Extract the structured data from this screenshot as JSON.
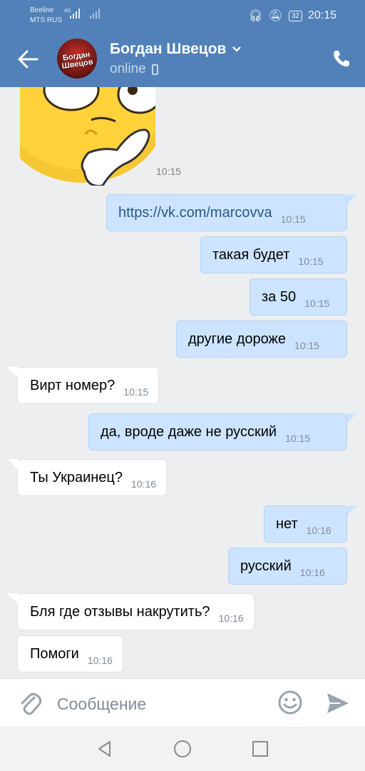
{
  "status_bar": {
    "carrier_line1": "Beeline",
    "carrier_line2": "MTS RUS",
    "network_tag": "4G",
    "battery": "32",
    "time": "20:15"
  },
  "header": {
    "contact_name": "Богдан Швецов",
    "status": "online",
    "avatar_text_line1": "Богдан",
    "avatar_text_line2": "Швецов"
  },
  "sticker": {
    "time": "10:15",
    "icon": "thinking-face-sticker"
  },
  "messages": [
    {
      "dir": "out",
      "text": "https://vk.com/marcovva",
      "time": "10:15",
      "link": true
    },
    {
      "dir": "out",
      "text": "такая будет",
      "time": "10:15"
    },
    {
      "dir": "out",
      "text": "за 50",
      "time": "10:15"
    },
    {
      "dir": "out",
      "text": "другие дороже",
      "time": "10:15"
    },
    {
      "dir": "in",
      "text": "Вирт номер?",
      "time": "10:15"
    },
    {
      "dir": "out",
      "text": "да, вроде даже не русский",
      "time": "10:15"
    },
    {
      "dir": "in",
      "text": "Ты Украинец?",
      "time": "10:16"
    },
    {
      "dir": "out",
      "text": "нет",
      "time": "10:16"
    },
    {
      "dir": "out",
      "text": "русский",
      "time": "10:16"
    },
    {
      "dir": "in",
      "text": "Бля где отзывы накрутить?",
      "time": "10:16"
    },
    {
      "dir": "in",
      "text": "Помоги",
      "time": "10:16"
    }
  ],
  "composer": {
    "placeholder": "Сообщение"
  },
  "colors": {
    "header": "#5181b8",
    "outgoing": "#cce4ff",
    "incoming": "#ffffff",
    "background": "#edeef0",
    "link": "#2a5885"
  }
}
